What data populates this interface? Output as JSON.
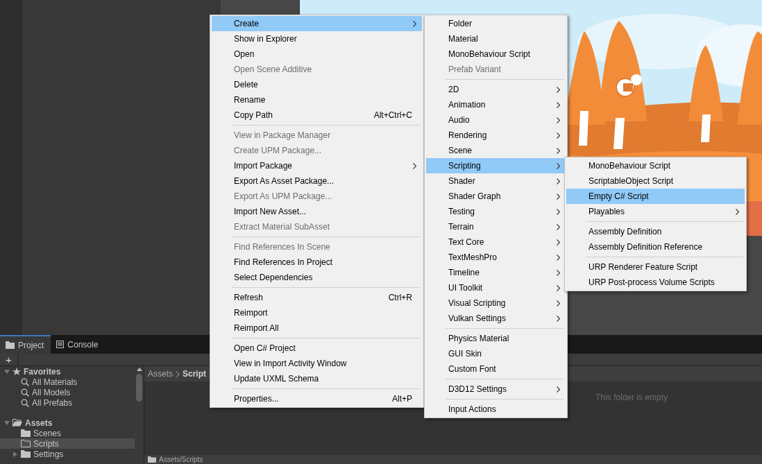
{
  "context_menu": {
    "groups": [
      [
        {
          "label": "Create",
          "disabled": false,
          "selected": true,
          "submenu": true
        },
        {
          "label": "Show in Explorer",
          "disabled": false,
          "selected": false,
          "submenu": false
        },
        {
          "label": "Open",
          "disabled": false,
          "selected": false,
          "submenu": false
        },
        {
          "label": "Open Scene Additive",
          "disabled": true,
          "selected": false,
          "submenu": false
        },
        {
          "label": "Delete",
          "disabled": false,
          "selected": false,
          "submenu": false
        },
        {
          "label": "Rename",
          "disabled": false,
          "selected": false,
          "submenu": false
        },
        {
          "label": "Copy Path",
          "shortcut": "Alt+Ctrl+C",
          "disabled": false,
          "selected": false,
          "submenu": false
        }
      ],
      [
        {
          "label": "View in Package Manager",
          "disabled": true,
          "selected": false,
          "submenu": false
        },
        {
          "label": "Create UPM Package...",
          "disabled": true,
          "selected": false,
          "submenu": false
        },
        {
          "label": "Import Package",
          "disabled": false,
          "selected": false,
          "submenu": true
        },
        {
          "label": "Export As Asset Package...",
          "disabled": false,
          "selected": false,
          "submenu": false
        },
        {
          "label": "Export As UPM Package...",
          "disabled": true,
          "selected": false,
          "submenu": false
        },
        {
          "label": "Import New Asset...",
          "disabled": false,
          "selected": false,
          "submenu": false
        },
        {
          "label": "Extract Material SubAsset",
          "disabled": true,
          "selected": false,
          "submenu": false
        }
      ],
      [
        {
          "label": "Find References In Scene",
          "disabled": true,
          "selected": false,
          "submenu": false
        },
        {
          "label": "Find References In Project",
          "disabled": false,
          "selected": false,
          "submenu": false
        },
        {
          "label": "Select Dependencies",
          "disabled": false,
          "selected": false,
          "submenu": false
        }
      ],
      [
        {
          "label": "Refresh",
          "shortcut": "Ctrl+R",
          "disabled": false,
          "selected": false,
          "submenu": false
        },
        {
          "label": "Reimport",
          "disabled": false,
          "selected": false,
          "submenu": false
        },
        {
          "label": "Reimport All",
          "disabled": false,
          "selected": false,
          "submenu": false
        }
      ],
      [
        {
          "label": "Open C# Project",
          "disabled": false,
          "selected": false,
          "submenu": false
        },
        {
          "label": "View in Import Activity Window",
          "disabled": false,
          "selected": false,
          "submenu": false
        },
        {
          "label": "Update UXML Schema",
          "disabled": false,
          "selected": false,
          "submenu": false
        }
      ],
      [
        {
          "label": "Properties...",
          "shortcut": "Alt+P",
          "disabled": false,
          "selected": false,
          "submenu": false
        }
      ]
    ]
  },
  "create_submenu": {
    "groups": [
      [
        {
          "label": "Folder",
          "disabled": false,
          "selected": false,
          "submenu": false
        },
        {
          "label": "Material",
          "disabled": false,
          "selected": false,
          "submenu": false
        },
        {
          "label": "MonoBehaviour Script",
          "disabled": false,
          "selected": false,
          "submenu": false
        },
        {
          "label": "Prefab Variant",
          "disabled": true,
          "selected": false,
          "submenu": false
        }
      ],
      [
        {
          "label": "2D",
          "disabled": false,
          "selected": false,
          "submenu": true
        },
        {
          "label": "Animation",
          "disabled": false,
          "selected": false,
          "submenu": true
        },
        {
          "label": "Audio",
          "disabled": false,
          "selected": false,
          "submenu": true
        },
        {
          "label": "Rendering",
          "disabled": false,
          "selected": false,
          "submenu": true
        },
        {
          "label": "Scene",
          "disabled": false,
          "selected": false,
          "submenu": true
        },
        {
          "label": "Scripting",
          "disabled": false,
          "selected": true,
          "submenu": true
        },
        {
          "label": "Shader",
          "disabled": false,
          "selected": false,
          "submenu": true
        },
        {
          "label": "Shader Graph",
          "disabled": false,
          "selected": false,
          "submenu": true
        },
        {
          "label": "Testing",
          "disabled": false,
          "selected": false,
          "submenu": true
        },
        {
          "label": "Terrain",
          "disabled": false,
          "selected": false,
          "submenu": true
        },
        {
          "label": "Text Core",
          "disabled": false,
          "selected": false,
          "submenu": true
        },
        {
          "label": "TextMeshPro",
          "disabled": false,
          "selected": false,
          "submenu": true
        },
        {
          "label": "Timeline",
          "disabled": false,
          "selected": false,
          "submenu": true
        },
        {
          "label": "UI Toolkit",
          "disabled": false,
          "selected": false,
          "submenu": true
        },
        {
          "label": "Visual Scripting",
          "disabled": false,
          "selected": false,
          "submenu": true
        },
        {
          "label": "Vulkan Settings",
          "disabled": false,
          "selected": false,
          "submenu": true
        }
      ],
      [
        {
          "label": "Physics Material",
          "disabled": false,
          "selected": false,
          "submenu": false
        },
        {
          "label": "GUI Skin",
          "disabled": false,
          "selected": false,
          "submenu": false
        },
        {
          "label": "Custom Font",
          "disabled": false,
          "selected": false,
          "submenu": false
        }
      ],
      [
        {
          "label": "D3D12 Settings",
          "disabled": false,
          "selected": false,
          "submenu": true
        }
      ],
      [
        {
          "label": "Input Actions",
          "disabled": false,
          "selected": false,
          "submenu": false
        }
      ]
    ]
  },
  "scripting_submenu": {
    "groups": [
      [
        {
          "label": "MonoBehaviour Script",
          "disabled": false,
          "selected": false,
          "submenu": false
        },
        {
          "label": "ScriptableObject Script",
          "disabled": false,
          "selected": false,
          "submenu": false
        },
        {
          "label": "Empty C# Script",
          "disabled": false,
          "selected": true,
          "submenu": false
        },
        {
          "label": "Playables",
          "disabled": false,
          "selected": false,
          "submenu": true
        }
      ],
      [
        {
          "label": "Assembly Definition",
          "disabled": false,
          "selected": false,
          "submenu": false
        },
        {
          "label": "Assembly Definition Reference",
          "disabled": false,
          "selected": false,
          "submenu": false
        }
      ],
      [
        {
          "label": "URP Renderer Feature Script",
          "disabled": false,
          "selected": false,
          "submenu": false
        },
        {
          "label": "URP Post-process Volume Scripts",
          "disabled": false,
          "selected": false,
          "submenu": false
        }
      ]
    ]
  },
  "bottom_tabs": [
    {
      "label": "Project",
      "kind": "folder",
      "selected": true
    },
    {
      "label": "Console",
      "kind": "console",
      "selected": false
    }
  ],
  "project_tree": [
    {
      "label": "Favorites",
      "kind": "favorites",
      "expanded": true,
      "selected": false,
      "children": [
        {
          "label": "All Materials",
          "kind": "search",
          "selected": false
        },
        {
          "label": "All Models",
          "kind": "search",
          "selected": false
        },
        {
          "label": "All Prefabs",
          "kind": "search",
          "selected": false
        }
      ]
    },
    {
      "label": "Assets",
      "kind": "folder",
      "expanded": true,
      "selected": false,
      "children": [
        {
          "label": "Scenes",
          "kind": "folder",
          "selected": false
        },
        {
          "label": "Scripts",
          "kind": "folder",
          "selected": true
        },
        {
          "label": "Settings",
          "kind": "folder",
          "expanded": false,
          "selected": false
        }
      ]
    }
  ],
  "breadcrumb": [
    "Assets",
    "Script"
  ],
  "empty_message": "This folder is empty",
  "footer_path": "Assets/Scripts",
  "add_button": "+"
}
